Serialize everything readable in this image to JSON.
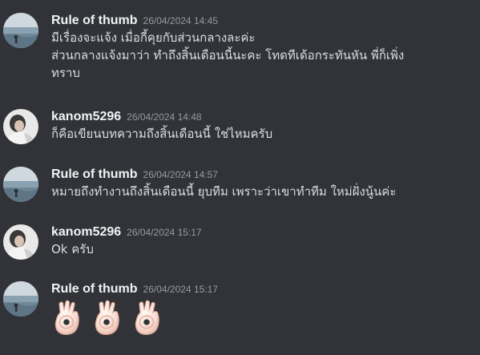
{
  "messages": [
    {
      "username": "Rule of thumb",
      "timestamp": "26/04/2024 14:45",
      "lines": [
        "มีเรื่องจะแจ้ง เมื่อกี้คุยกับส่วนกลางละค่ะ",
        "ส่วนกลางแจ้งมาว่า ทำถึงสิ้นเดือนนี้นะคะ โทดทีเด้อกระทันหัน พี่ก็เพิ่ง",
        "ทราบ"
      ]
    },
    {
      "username": "kanom5296",
      "timestamp": "26/04/2024 14:48",
      "lines": [
        "ก็คือเขียนบทความถึงสิ้นเดือนนี้ ใช่ไหมครับ"
      ]
    },
    {
      "username": "Rule of thumb",
      "timestamp": "26/04/2024 14:57",
      "lines": [
        "หมายถึงทำงานถึงสิ้นเดือนนี้ ยุบทีม เพราะว่าเขาทำทีม ใหม่ฝั่งนู้นค่ะ"
      ]
    },
    {
      "username": "kanom5296",
      "timestamp": "26/04/2024 15:17",
      "lines": [
        "Ok ครับ"
      ]
    },
    {
      "username": "Rule of thumb",
      "timestamp": "26/04/2024 15:17",
      "emoji": [
        "ok-hand",
        "ok-hand",
        "ok-hand"
      ]
    }
  ],
  "colors": {
    "background": "#313338",
    "username": "#f2f3f5",
    "timestamp": "#949ba4",
    "text": "#dbdee1"
  }
}
